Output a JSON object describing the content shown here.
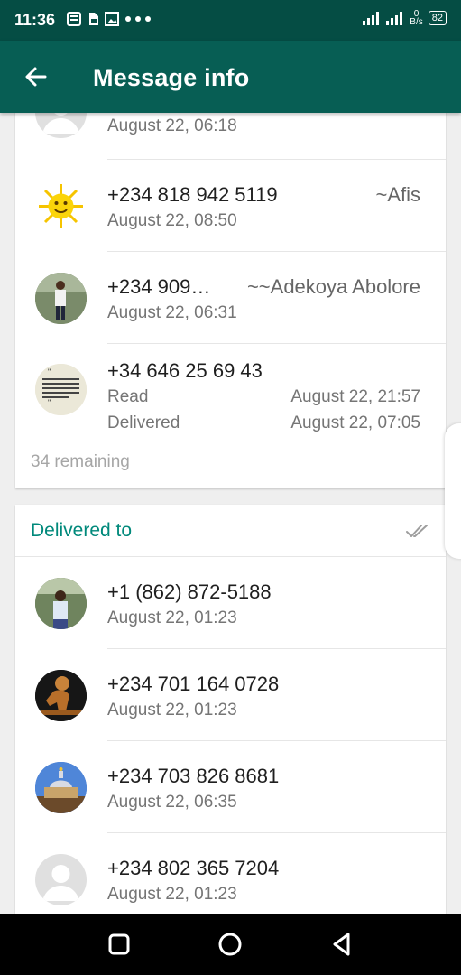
{
  "status_bar": {
    "time": "11:36",
    "net_speed_value": "0",
    "net_speed_unit": "B/s",
    "battery": "82"
  },
  "app_bar": {
    "title": "Message info"
  },
  "read_by": {
    "remaining": "34 remaining",
    "contacts": [
      {
        "name": "",
        "time": "August 22, 06:18",
        "avatar": "default"
      },
      {
        "name": "+234 818 942 5119",
        "alias": "~Afis",
        "time": "August 22, 08:50",
        "avatar": "sun"
      },
      {
        "name": "+234 909…",
        "alias": "~~Adekoya Abolore",
        "time": "August 22, 06:31",
        "avatar": "person-standing"
      },
      {
        "name": "+34 646 25 69 43",
        "read_label": "Read",
        "read_time": "August 22, 21:57",
        "delivered_label": "Delivered",
        "delivered_time": "August 22, 07:05",
        "avatar": "quote-text"
      }
    ]
  },
  "delivered_to": {
    "title": "Delivered to",
    "contacts": [
      {
        "name": "+1 (862) 872-5188",
        "time": "August 22, 01:23",
        "avatar": "person-outdoor"
      },
      {
        "name": "+234 701 164 0728",
        "time": "August 22, 01:23",
        "avatar": "sculpture"
      },
      {
        "name": "+234 703 826 8681",
        "time": "August 22, 06:35",
        "avatar": "building"
      },
      {
        "name": "+234 802 365 7204",
        "time": "August 22, 01:23",
        "avatar": "default"
      }
    ]
  },
  "colors": {
    "status_bar": "#054d44",
    "app_bar": "#075e54",
    "accent": "#00897b"
  }
}
